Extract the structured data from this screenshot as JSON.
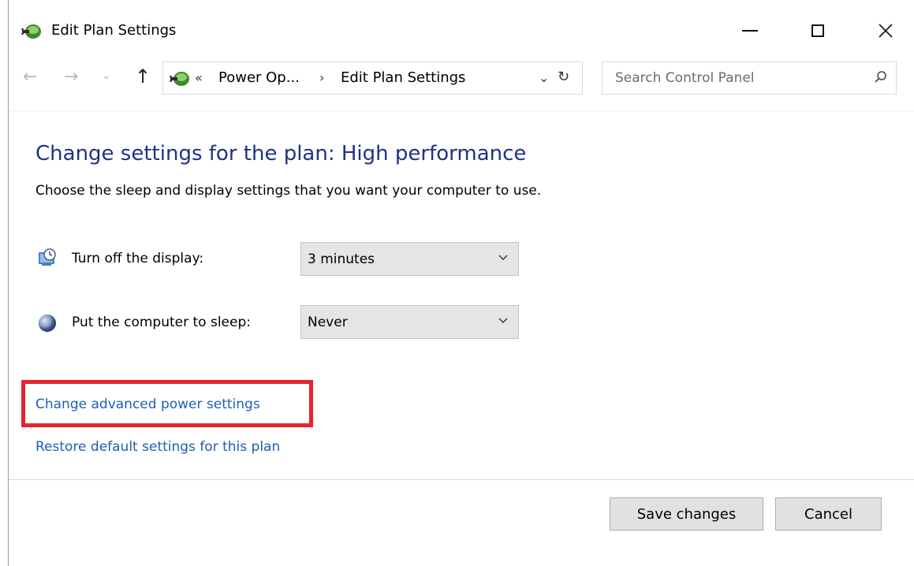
{
  "window": {
    "title": "Edit Plan Settings",
    "controls": {
      "minimize": "minimize",
      "maximize": "maximize",
      "close": "✕"
    }
  },
  "nav": {
    "back": "←",
    "forward": "→",
    "recent": "⌄",
    "up": "↑",
    "address": {
      "prefix": "«",
      "crumb1": "Power Op...",
      "separator": "›",
      "crumb2": "Edit Plan Settings",
      "dropdown": "⌄",
      "refresh": "↻"
    },
    "search": {
      "placeholder": "Search Control Panel"
    }
  },
  "main": {
    "heading": "Change settings for the plan: High performance",
    "subheading": "Choose the sleep and display settings that you want your computer to use.",
    "settings": [
      {
        "label": "Turn off the display:",
        "value": "3 minutes",
        "icon": "display-timer-icon"
      },
      {
        "label": "Put the computer to sleep:",
        "value": "Never",
        "icon": "sleep-moon-icon"
      }
    ],
    "links": {
      "advanced": "Change advanced power settings",
      "restore": "Restore default settings for this plan"
    }
  },
  "footer": {
    "save": "Save changes",
    "cancel": "Cancel"
  },
  "colors": {
    "heading": "#1e3287",
    "link": "#1f5fb0",
    "highlight": "#e8232f"
  }
}
